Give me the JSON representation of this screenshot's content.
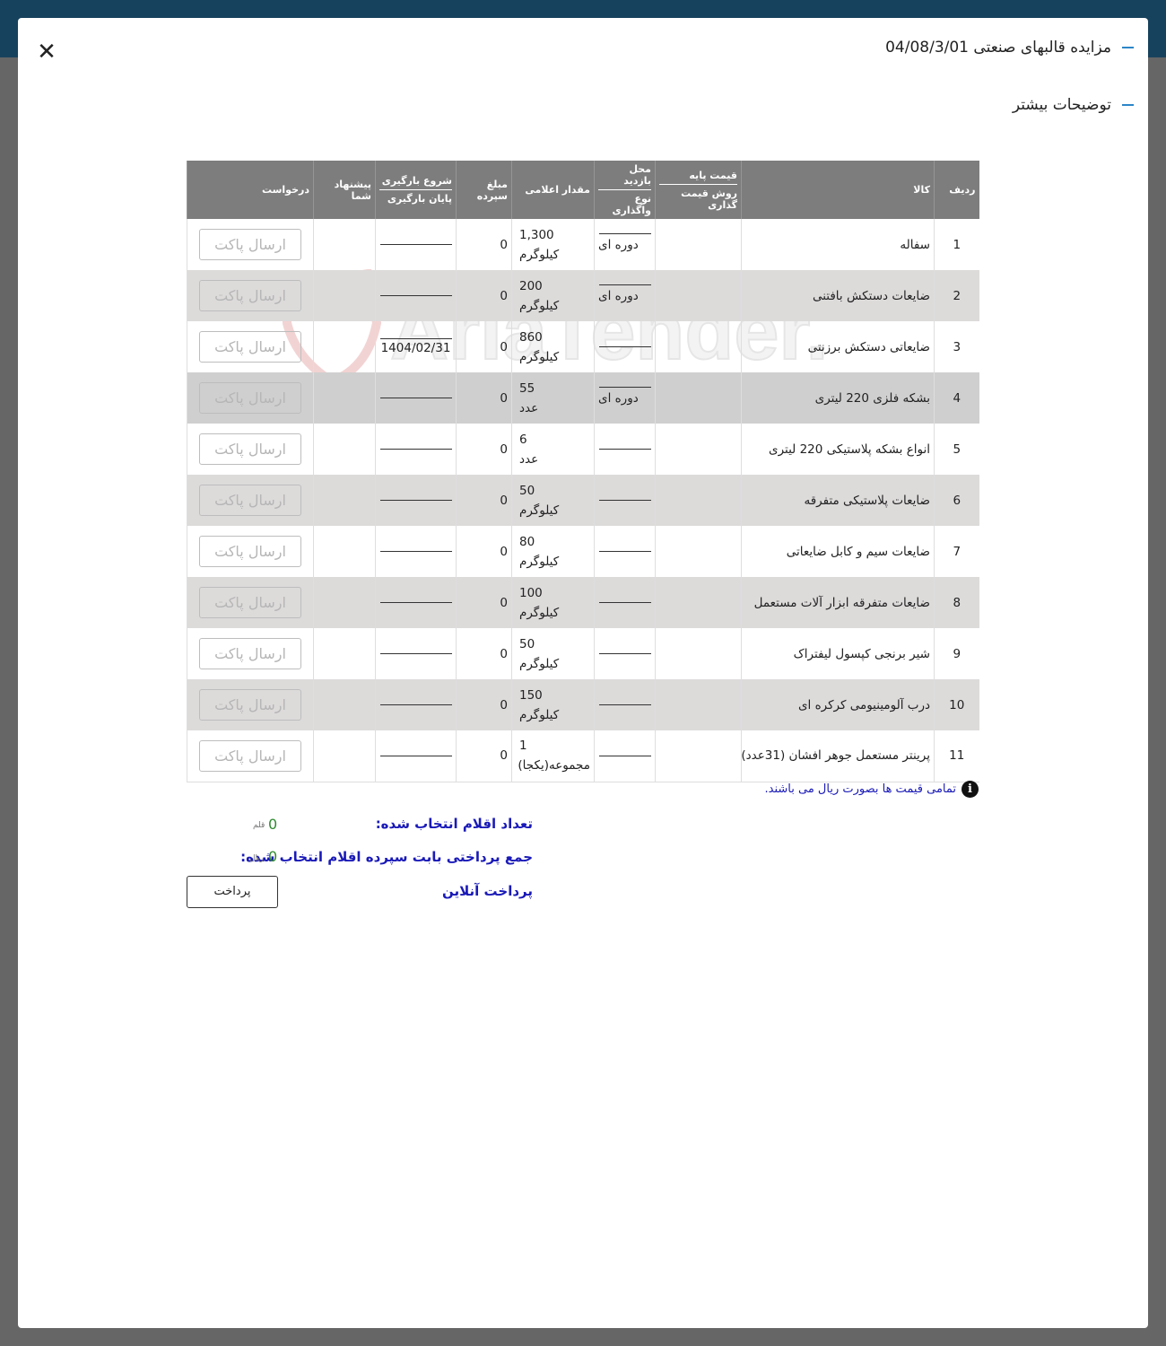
{
  "header": {
    "title": "مزایده قالبهای صنعتی 04/08/3/01",
    "more_info": "توضیحات بیشتر",
    "close_icon": "close-icon"
  },
  "table": {
    "headers": {
      "row": "ردیف",
      "item": "کالا",
      "base_price": "قیمت پایه",
      "pricing_method": "روش قیمت گذاری",
      "visit_place": "محل بازدید",
      "transfer_type": "نوع واگذاری",
      "quantity": "مقدار اعلامی",
      "deposit": "مبلغ سپرده",
      "load_start": "شروع بارگیری",
      "load_end": "پایان بارگیری",
      "offer": "پیشنهاد شما",
      "request": "درخواست"
    },
    "rows": [
      {
        "num": "1",
        "item": "سفاله",
        "transfer": "دوره ای",
        "qty": "1,300",
        "unit": "کیلوگرم",
        "deposit": "0",
        "load": ""
      },
      {
        "num": "2",
        "item": "ضایعات دستکش بافتنی",
        "transfer": "دوره ای",
        "qty": "200",
        "unit": "کیلوگرم",
        "deposit": "0",
        "load": ""
      },
      {
        "num": "3",
        "item": "ضایعاتی دستکش برزنتی",
        "transfer": "",
        "qty": "860",
        "unit": "کیلوگرم",
        "deposit": "0",
        "load": "1404/02/31"
      },
      {
        "num": "4",
        "item": "بشکه فلزی 220 لیتری",
        "transfer": "دوره ای",
        "qty": "55",
        "unit": "عدد",
        "deposit": "0",
        "load": ""
      },
      {
        "num": "5",
        "item": "انواع بشکه پلاستیکی 220 لیتری",
        "transfer": "",
        "qty": "6",
        "unit": "عدد",
        "deposit": "0",
        "load": ""
      },
      {
        "num": "6",
        "item": "ضایعات پلاستیکی متفرقه",
        "transfer": "",
        "qty": "50",
        "unit": "کیلوگرم",
        "deposit": "0",
        "load": ""
      },
      {
        "num": "7",
        "item": "ضایعات سیم و کابل ضایعاتی",
        "transfer": "",
        "qty": "80",
        "unit": "کیلوگرم",
        "deposit": "0",
        "load": ""
      },
      {
        "num": "8",
        "item": "ضایعات متفرقه ابزار آلات مستعمل",
        "transfer": "",
        "qty": "100",
        "unit": "کیلوگرم",
        "deposit": "0",
        "load": ""
      },
      {
        "num": "9",
        "item": "شیر برنجی کپسول لیفتراک",
        "transfer": "",
        "qty": "50",
        "unit": "کیلوگرم",
        "deposit": "0",
        "load": ""
      },
      {
        "num": "10",
        "item": "درب آلومینیومی کرکره ای",
        "transfer": "",
        "qty": "150",
        "unit": "کیلوگرم",
        "deposit": "0",
        "load": ""
      },
      {
        "num": "11",
        "item": "پرینتر مستعمل جوهر افشان (31عدد)",
        "transfer": "",
        "qty": "1",
        "unit": "مجموعه(یکجا)",
        "deposit": "0",
        "load": ""
      }
    ],
    "send_packet_label": "ارسال پاکت"
  },
  "note": {
    "icon": "info-icon",
    "text": "تمامی قیمت ها بصورت ریال می باشند."
  },
  "summary": {
    "count_label": "تعداد اقلام انتخاب شده:",
    "count_value": "0",
    "count_unit": "قلم",
    "total_label": "جمع پرداختی بابت سپرده اقلام انتخاب شده:",
    "total_value": "0",
    "total_unit": "ریال",
    "online_label": "پرداخت آنلاین",
    "pay_button": "پرداخت"
  },
  "watermark": "AriaTender.neT",
  "colors": {
    "topbar": "#17425e",
    "header_bg": "#7d7d7d",
    "accent_dash": "#2c86c7",
    "label_blue": "#1a1ab8",
    "value_green": "#2e8b2e"
  }
}
